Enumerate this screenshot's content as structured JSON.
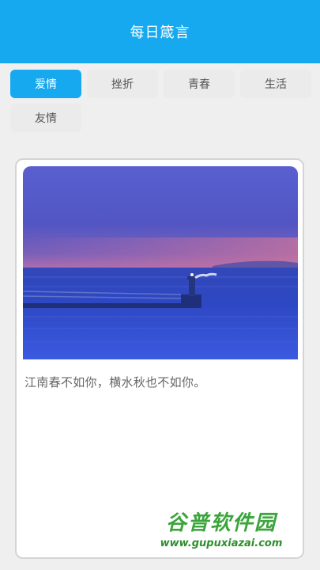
{
  "header": {
    "title": "每日箴言"
  },
  "tabs": [
    {
      "label": "爱情",
      "active": true
    },
    {
      "label": "挫折",
      "active": false
    },
    {
      "label": "青春",
      "active": false
    },
    {
      "label": "生活",
      "active": false
    },
    {
      "label": "友情",
      "active": false
    }
  ],
  "card": {
    "image_description": "illustration-sea-lighthouse-moon",
    "quote": "江南春不如你，横水秋也不如你。"
  },
  "watermark": {
    "logo_text": "谷普软件园",
    "url": "www.gupuxiazai.com"
  },
  "colors": {
    "accent": "#16a9f0",
    "page_background": "#efefef",
    "tab_background": "#ebebeb"
  }
}
